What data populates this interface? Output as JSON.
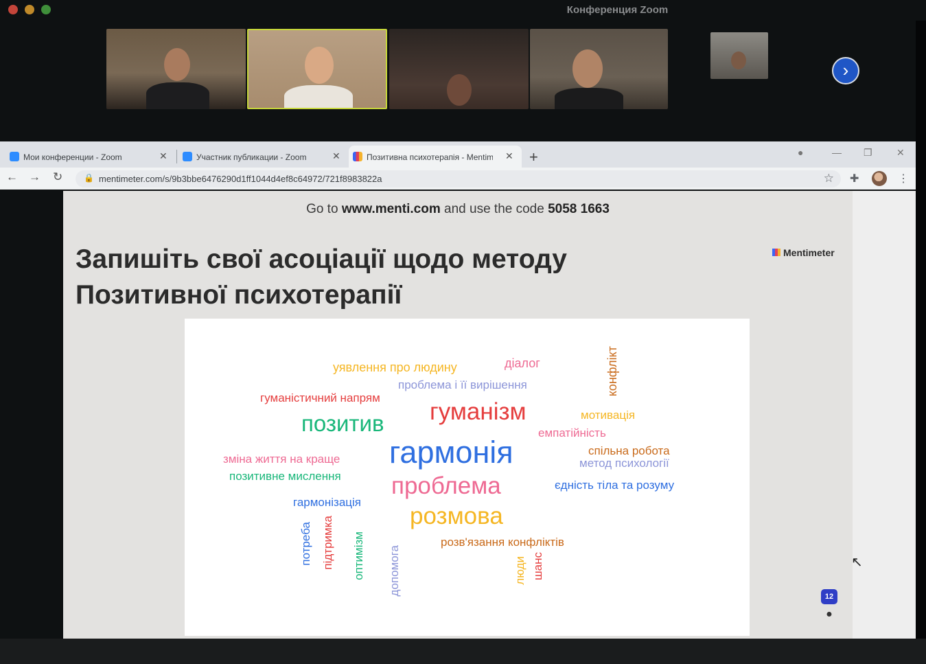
{
  "zoom": {
    "title": "Конференция Zoom",
    "next_icon": "chevron-right-icon"
  },
  "browser": {
    "tabs": [
      {
        "label": "Мои конференции - Zoom",
        "icon": "zoom-icon"
      },
      {
        "label": "Участник публикации - Zoom",
        "icon": "zoom-icon"
      },
      {
        "label": "Позитивна психотерапія - Mentimeter",
        "icon": "mentimeter-icon"
      }
    ],
    "url": "mentimeter.com/s/9b3bbe6476290d1ff1044d4ef8c64972/721f8983822a"
  },
  "slide": {
    "join_prefix": "Go to ",
    "join_site": "www.menti.com",
    "join_middle": " and use the code ",
    "join_code": "5058 1663",
    "title": "Запишіть свої асоціації щодо методу Позитивної психотерапії",
    "brand": "Mentimeter",
    "audience_count": "12"
  },
  "colors": {
    "red": "#e53e3e",
    "blue": "#2f6fe0",
    "pink": "#ee6a93",
    "teal": "#19b77a",
    "yellow": "#f5b623",
    "orange": "#c96a1a",
    "lavender": "#8c95d8"
  },
  "word_cloud": [
    {
      "text": "уявлення про людину",
      "color": "#f5b623"
    },
    {
      "text": "діалог",
      "color": "#ee6a93"
    },
    {
      "text": "конфлікт",
      "color": "#c96a1a"
    },
    {
      "text": "проблема і її вирішення",
      "color": "#8c95d8"
    },
    {
      "text": "гуманістичний напрям",
      "color": "#e53e3e"
    },
    {
      "text": "гуманізм",
      "color": "#e53e3e"
    },
    {
      "text": "мотивація",
      "color": "#f5b623"
    },
    {
      "text": "позитив",
      "color": "#19b77a"
    },
    {
      "text": "емпатійність",
      "color": "#ee6a93"
    },
    {
      "text": "гармонія",
      "color": "#2f6fe0"
    },
    {
      "text": "зміна життя на краще",
      "color": "#ee6a93"
    },
    {
      "text": "спільна робота",
      "color": "#c96a1a"
    },
    {
      "text": "метод психології",
      "color": "#8c95d8"
    },
    {
      "text": "позитивне мислення",
      "color": "#19b77a"
    },
    {
      "text": "проблема",
      "color": "#ee6a93"
    },
    {
      "text": "єдність тіла та розуму",
      "color": "#2f6fe0"
    },
    {
      "text": "гармонізація",
      "color": "#2f6fe0"
    },
    {
      "text": "розмова",
      "color": "#f5b623"
    },
    {
      "text": "потреба",
      "color": "#2f6fe0"
    },
    {
      "text": "підтримка",
      "color": "#e53e3e"
    },
    {
      "text": "оптимізм",
      "color": "#19b77a"
    },
    {
      "text": "допомога",
      "color": "#8c95d8"
    },
    {
      "text": "розв'язання конфліктів",
      "color": "#c96a1a"
    },
    {
      "text": "люди",
      "color": "#f5b623"
    },
    {
      "text": "шанс",
      "color": "#e53e3e"
    }
  ]
}
